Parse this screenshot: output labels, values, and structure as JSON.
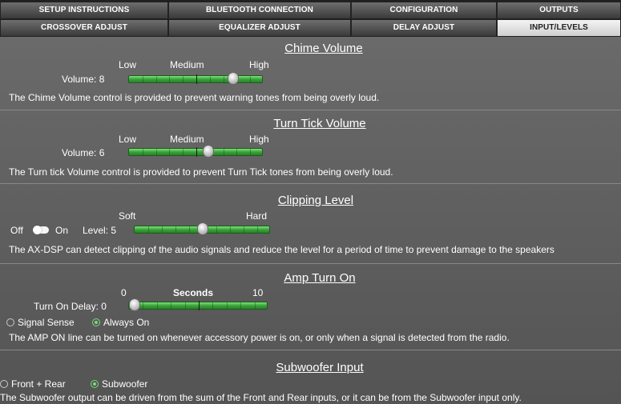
{
  "tabs": {
    "row1": [
      "SETUP INSTRUCTIONS",
      "BLUETOOTH CONNECTION",
      "CONFIGURATION",
      "OUTPUTS"
    ],
    "row2": [
      "CROSSOVER ADJUST",
      "EQUALIZER ADJUST",
      "DELAY ADJUST",
      "INPUT/LEVELS"
    ],
    "active": "INPUT/LEVELS"
  },
  "chime": {
    "title": "Chime Volume",
    "low": "Low",
    "medium": "Medium",
    "high": "High",
    "value_label": "Volume: 8",
    "value": 8,
    "max": 10,
    "description": "The Chime Volume control is provided to prevent warning tones from being overly loud."
  },
  "turn_tick": {
    "title": "Turn Tick Volume",
    "low": "Low",
    "medium": "Medium",
    "high": "High",
    "value_label": "Volume: 6",
    "value": 6,
    "max": 10,
    "description": "The Turn tick Volume control is provided to prevent Turn Tick tones from being overly loud."
  },
  "clipping": {
    "title": "Clipping Level",
    "soft": "Soft",
    "hard": "Hard",
    "off": "Off",
    "on": "On",
    "value_label": "Level: 5",
    "value": 5,
    "max": 10,
    "toggle_state": "off",
    "description": "The AX-DSP can detect clipping of the audio signals and reduce the level for a period of time to prevent damage to the speakers"
  },
  "amp": {
    "title": "Amp Turn On",
    "min_label": "0",
    "seconds": "Seconds",
    "max_label": "10",
    "value_label": "Turn On Delay: 0",
    "value": 0,
    "max": 10,
    "options": [
      "Signal Sense",
      "Always On"
    ],
    "selected": "Always On",
    "description": "The AMP ON line can be turned on whenever accessory power is on, or only when a signal is detected from the radio."
  },
  "subwoofer": {
    "title": "Subwoofer Input",
    "options": [
      "Front + Rear",
      "Subwoofer"
    ],
    "selected": "Subwoofer",
    "description": "The Subwoofer output can be driven from the sum of the Front and Rear inputs, or it can be from the Subwoofer input only."
  },
  "colors": {
    "slider_green": "#3aa43a",
    "radio_green": "#7bd97b",
    "panel": "#5a5a5a"
  }
}
